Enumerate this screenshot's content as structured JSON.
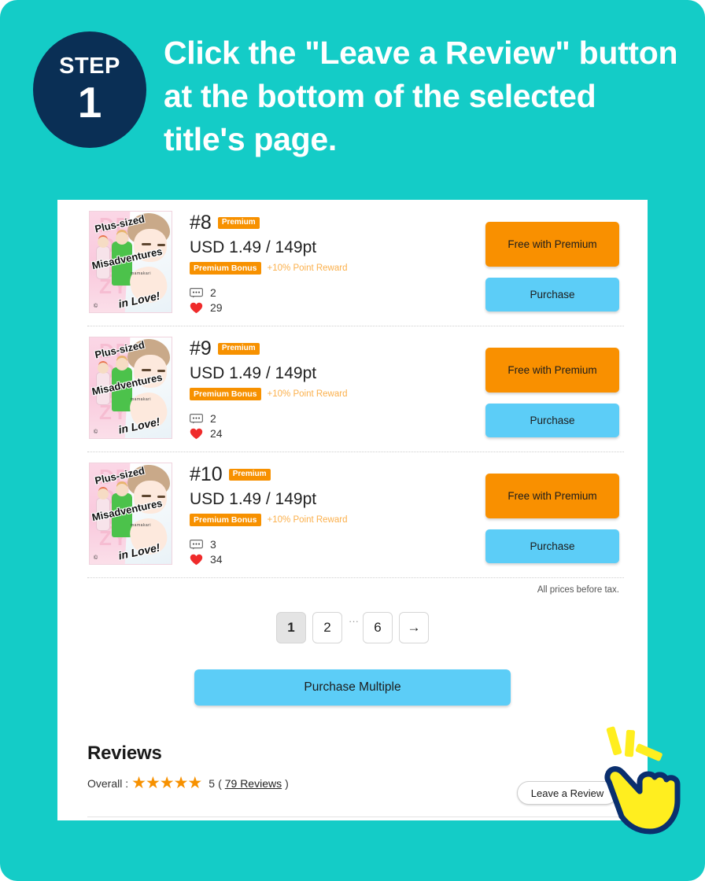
{
  "header": {
    "step_word": "STEP",
    "step_number": "1",
    "headline": "Click the \"Leave a Review\" button at the bottom of the selected title's page.",
    "badge_color": "#0a2f55",
    "background_color": "#14ccc7"
  },
  "products": [
    {
      "number": "#8",
      "premium_badge": "Premium",
      "price": "USD 1.49 / 149pt",
      "bonus_badge": "Premium Bonus",
      "bonus_text": "+10% Point Reward",
      "comments": "2",
      "likes": "29",
      "free_button": "Free with Premium",
      "purchase_button": "Purchase",
      "cover": {
        "line1": "Plus-sized",
        "line2": "Misadventures",
        "line3": "in Love!",
        "author": "mamakari",
        "mark": "©"
      }
    },
    {
      "number": "#9",
      "premium_badge": "Premium",
      "price": "USD 1.49 / 149pt",
      "bonus_badge": "Premium Bonus",
      "bonus_text": "+10% Point Reward",
      "comments": "2",
      "likes": "24",
      "free_button": "Free with Premium",
      "purchase_button": "Purchase",
      "cover": {
        "line1": "Plus-sized",
        "line2": "Misadventures",
        "line3": "in Love!",
        "author": "mamakari",
        "mark": "©"
      }
    },
    {
      "number": "#10",
      "premium_badge": "Premium",
      "price": "USD 1.49 / 149pt",
      "bonus_badge": "Premium Bonus",
      "bonus_text": "+10% Point Reward",
      "comments": "3",
      "likes": "34",
      "free_button": "Free with Premium",
      "purchase_button": "Purchase",
      "cover": {
        "line1": "Plus-sized",
        "line2": "Misadventures",
        "line3": "in Love!",
        "author": "mamakari",
        "mark": "©"
      }
    }
  ],
  "tax_note": "All prices before tax.",
  "pagination": {
    "pages": [
      "1",
      "2"
    ],
    "ellipsis": "···",
    "last_page": "6",
    "next_arrow": "→",
    "active_page": "1"
  },
  "purchase_multiple_label": "Purchase Multiple",
  "reviews": {
    "title": "Reviews",
    "overall_label": "Overall :",
    "stars": "★★★★★",
    "rating": "5",
    "count_text": "(79 Reviews)",
    "count_open_paren": "(",
    "count_link": "79 Reviews",
    "count_close_paren": ")",
    "leave_review_label": "Leave a Review",
    "star_color": "#f79100"
  },
  "colors": {
    "teal": "#14ccc7",
    "orange": "#f99000",
    "blue": "#5ccdf7",
    "navy": "#0a2f55",
    "cursor_yellow": "#ffee1f"
  }
}
